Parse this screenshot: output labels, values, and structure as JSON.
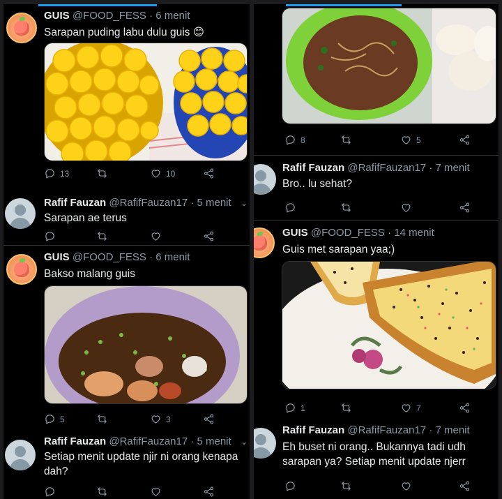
{
  "left": {
    "tweets": [
      {
        "name": "GUIS",
        "handle": "@FOOD_FESS · 6 menit",
        "text": "Sarapan puding labu dulu guis 😊",
        "replies": "13",
        "retweets": "",
        "likes": "10"
      },
      {
        "name": "Rafif Fauzan",
        "handle": "@RafifFauzan17 · 5 menit",
        "text": "Sarapan ae terus",
        "replies": "",
        "retweets": "",
        "likes": ""
      },
      {
        "name": "GUIS",
        "handle": "@FOOD_FESS · 6 menit",
        "text": "Bakso malang guis",
        "replies": "5",
        "retweets": "",
        "likes": "3"
      },
      {
        "name": "Rafif Fauzan",
        "handle": "@RafifFauzan17 · 5 menit",
        "text": "Setiap menit update njir ni orang kenapa dah?",
        "replies": "",
        "retweets": "",
        "likes": ""
      }
    ]
  },
  "right": {
    "top_actions": {
      "replies": "8",
      "retweets": "",
      "likes": "5"
    },
    "tweets": [
      {
        "name": "Rafif Fauzan",
        "handle": "@RafifFauzan17 · 7 menit",
        "text": "Bro.. lu sehat?",
        "replies": "",
        "retweets": "",
        "likes": ""
      },
      {
        "name": "GUIS",
        "handle": "@FOOD_FESS · 14 menit",
        "text": "Guis met sarapan yaa;)",
        "replies": "1",
        "retweets": "",
        "likes": "7"
      },
      {
        "name": "Rafif Fauzan",
        "handle": "@RafifFauzan17 · 7 menit",
        "text": "Eh buset ni orang.. Bukannya tadi udh sarapan ya? Setiap menit update njerr",
        "replies": "",
        "retweets": "",
        "likes": ""
      }
    ]
  },
  "icons": [
    "reply-icon",
    "retweet-icon",
    "like-icon",
    "share-icon",
    "chevron-down-icon"
  ],
  "colors": {
    "background": "#000000",
    "accent": "#1d9bf0",
    "muted": "#8b98a5",
    "text": "#e7e9ea"
  }
}
